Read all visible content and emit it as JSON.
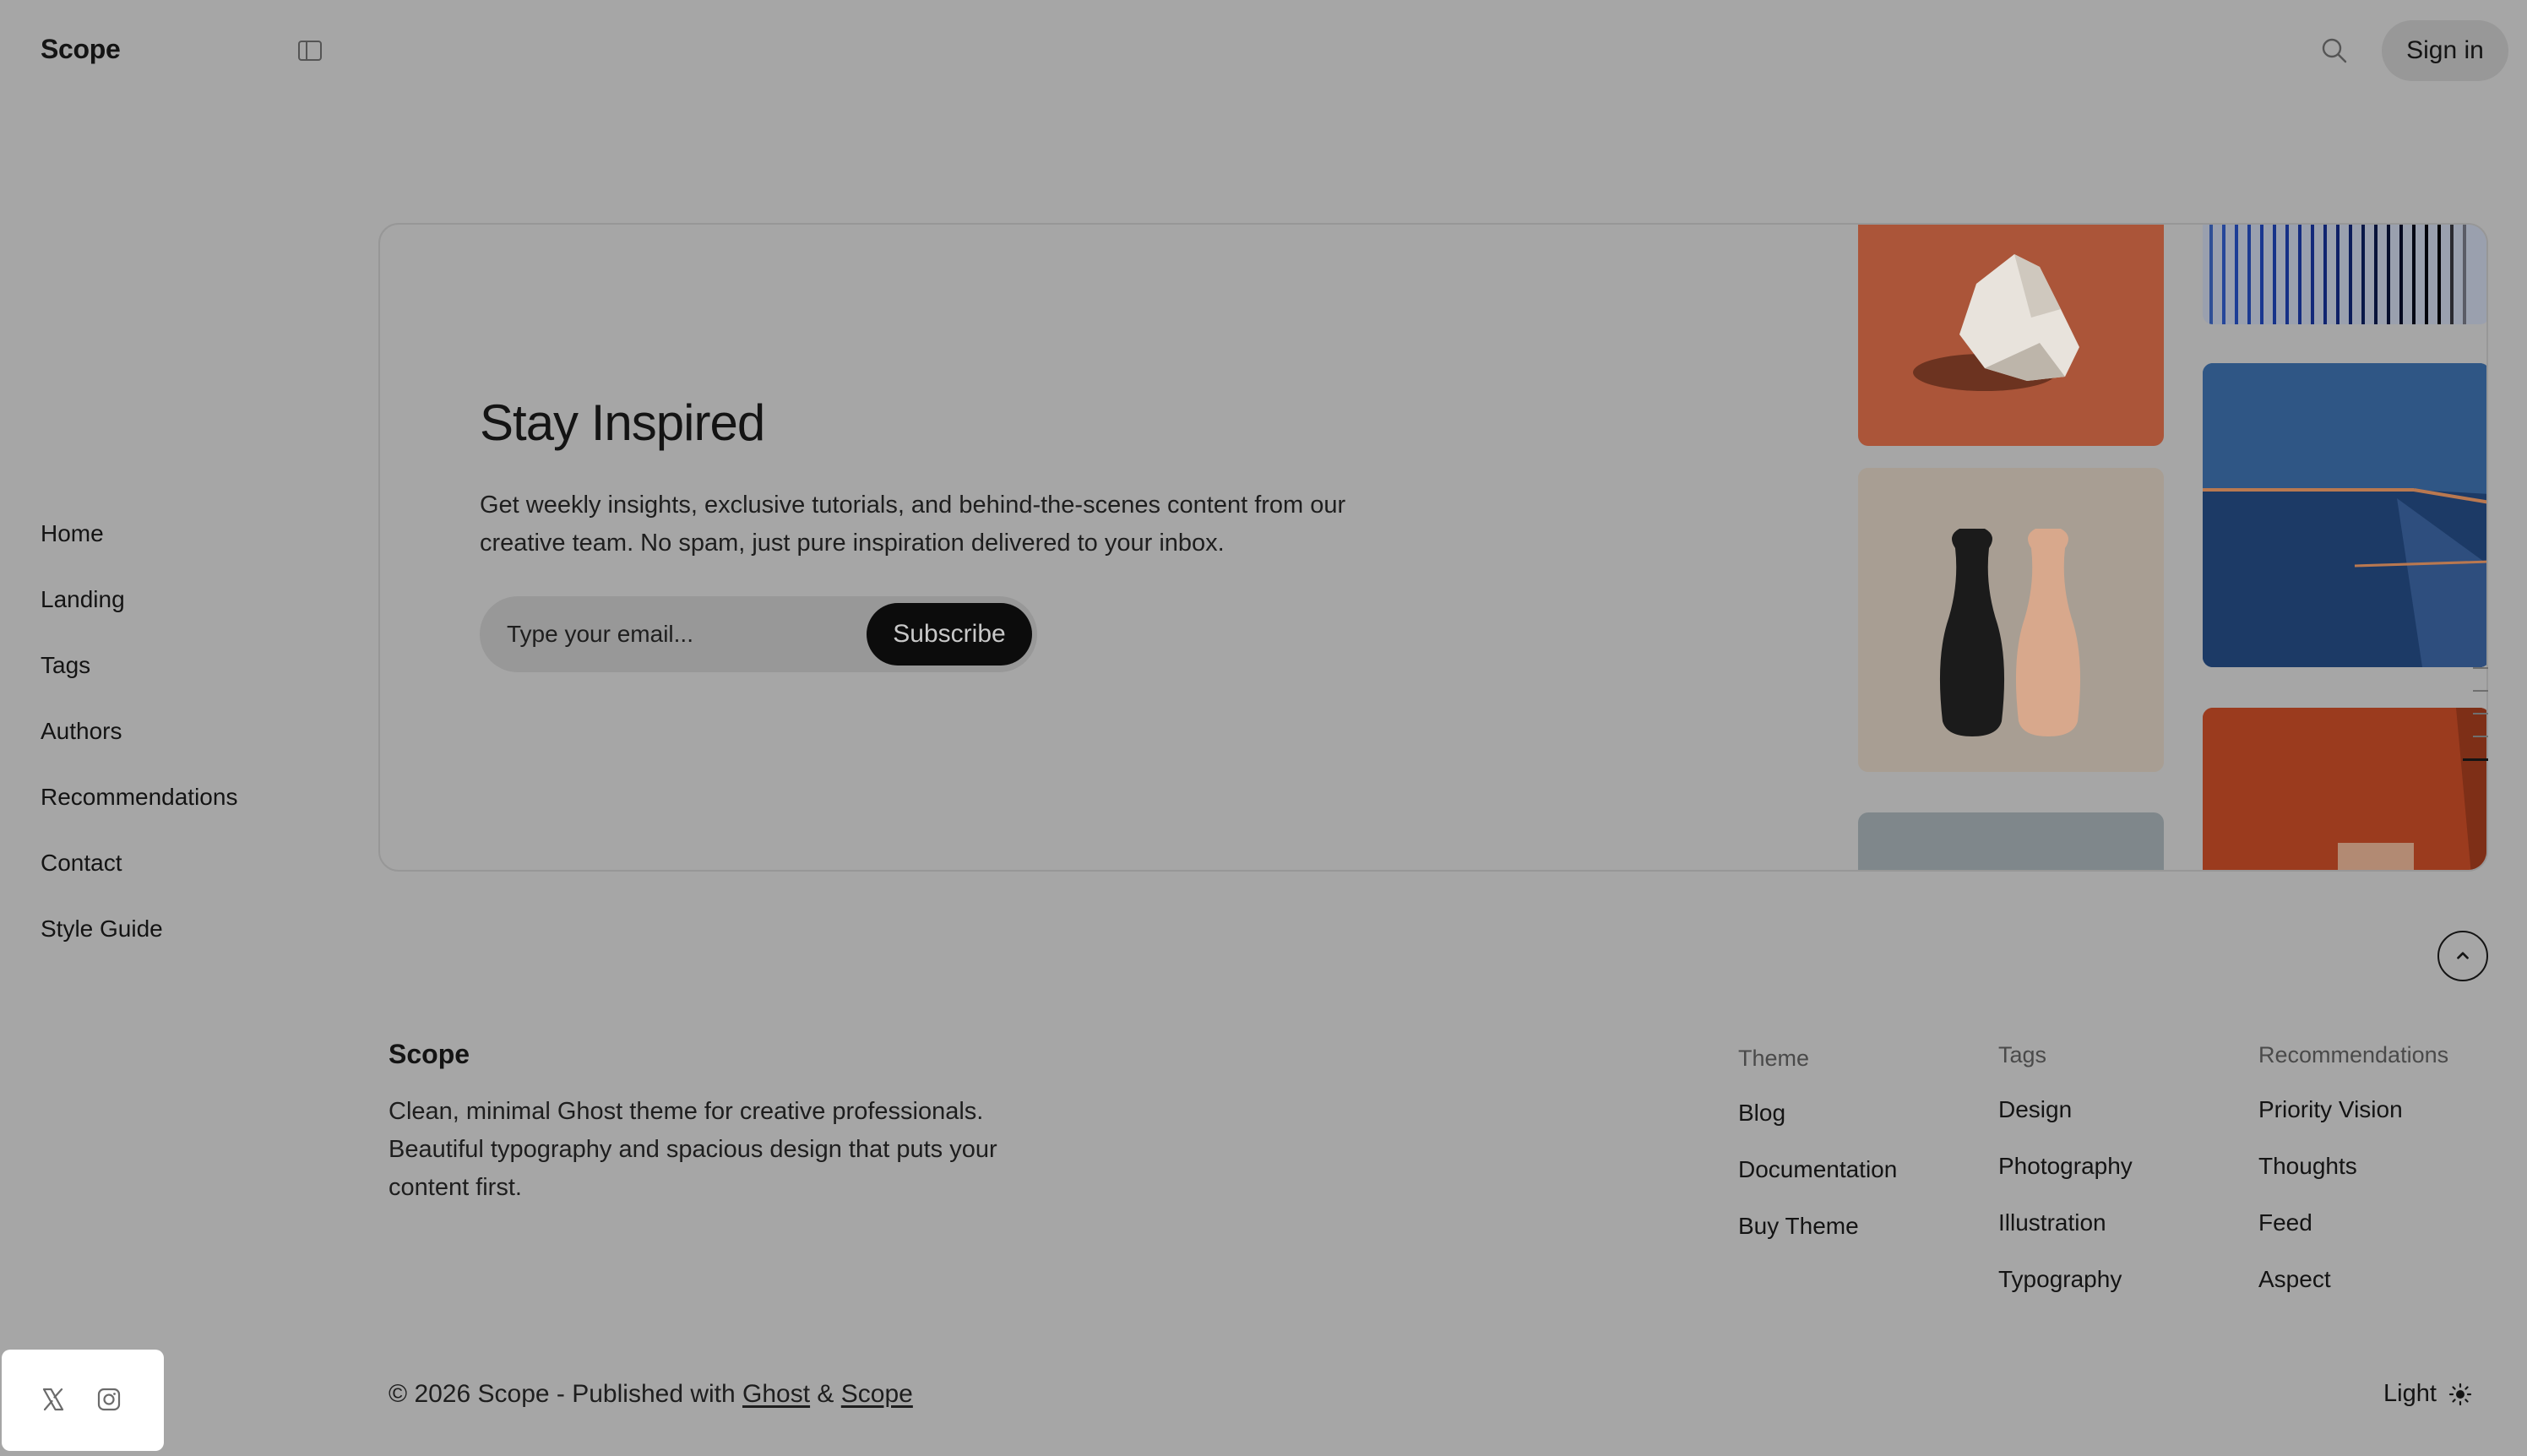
{
  "header": {
    "brand": "Scope",
    "signin_label": "Sign in",
    "icons": [
      "sidebar-toggle-icon",
      "search-icon"
    ]
  },
  "sidebar": {
    "items": [
      {
        "label": "Home"
      },
      {
        "label": "Landing"
      },
      {
        "label": "Tags"
      },
      {
        "label": "Authors"
      },
      {
        "label": "Recommendations"
      },
      {
        "label": "Contact"
      },
      {
        "label": "Style Guide"
      }
    ]
  },
  "hero": {
    "title": "Stay Inspired",
    "text": "Get weekly insights, exclusive tutorials, and behind-the-scenes content from our creative team. No spam, just pure inspiration delivered to your inbox.",
    "email_placeholder": "Type your email...",
    "subscribe_label": "Subscribe"
  },
  "footer": {
    "brand": "Scope",
    "description": "Clean, minimal Ghost theme for creative professionals. Beautiful typography and spacious design that puts your content first.",
    "columns": [
      {
        "heading": "Theme",
        "links": [
          "Blog",
          "Documentation",
          "Buy Theme"
        ]
      },
      {
        "heading": "Tags",
        "links": [
          "Design",
          "Photography",
          "Illustration",
          "Typography"
        ]
      },
      {
        "heading": "Recommendations",
        "links": [
          "Priority Vision",
          "Thoughts",
          "Feed",
          "Aspect"
        ]
      }
    ],
    "copyright_prefix": "© 2026 Scope - Published with",
    "ghost_link": "Ghost",
    "amp": "&",
    "scope_link": "Scope",
    "theme_toggle_label": "Light"
  },
  "social": {
    "icons": [
      "x-icon",
      "instagram-icon"
    ]
  },
  "colors": {
    "overlay_background": "#a6a6a6",
    "button_dark": "#0c0c0c",
    "text": "#141414"
  }
}
